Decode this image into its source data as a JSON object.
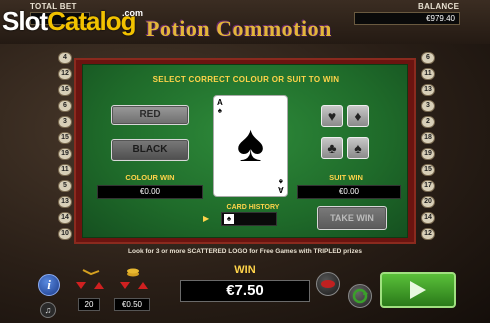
{
  "header": {
    "total_bet_label": "TOTAL BET",
    "balance_label": "BALANCE",
    "balance_value": "€979.40",
    "watermark_slot": "Slot",
    "watermark_catalog": "Catalog",
    "watermark_com": ".com",
    "game_title": "Potion Commotion"
  },
  "gamble": {
    "instruction": "SELECT CORRECT COLOUR OR SUIT TO WIN",
    "red_label": "RED",
    "black_label": "BLACK",
    "colour_win_label": "COLOUR WIN",
    "colour_win_value": "€0.00",
    "suit_win_label": "SUIT WIN",
    "suit_win_value": "€0.00",
    "suits": [
      "♥",
      "♦",
      "♣",
      "♠"
    ],
    "card_rank": "A",
    "card_suit": "♠",
    "card_history_label": "CARD HISTORY",
    "history_cards": [
      "♠"
    ],
    "take_win_label": "TAKE WIN"
  },
  "side_numbers": {
    "left": [
      "4",
      "12",
      "16",
      "6",
      "3",
      "15",
      "19",
      "11",
      "5",
      "13",
      "14",
      "10"
    ],
    "right": [
      "6",
      "11",
      "13",
      "3",
      "2",
      "18",
      "19",
      "15",
      "17",
      "20",
      "14",
      "12"
    ]
  },
  "footer": {
    "info_text": "Look for 3 or more SCATTERED LOGO for Free Games with TRIPLED prizes",
    "lines_value": "20",
    "bet_value": "€0.50",
    "win_label": "WIN",
    "win_value": "€7.50",
    "info_icon_text": "i",
    "sound_icon_text": "♫"
  },
  "colors": {
    "felt": "#1f6b2a",
    "accent_gold": "#ffd44a",
    "spin_green": "#3a9a2a",
    "board_red": "#6b1410"
  }
}
